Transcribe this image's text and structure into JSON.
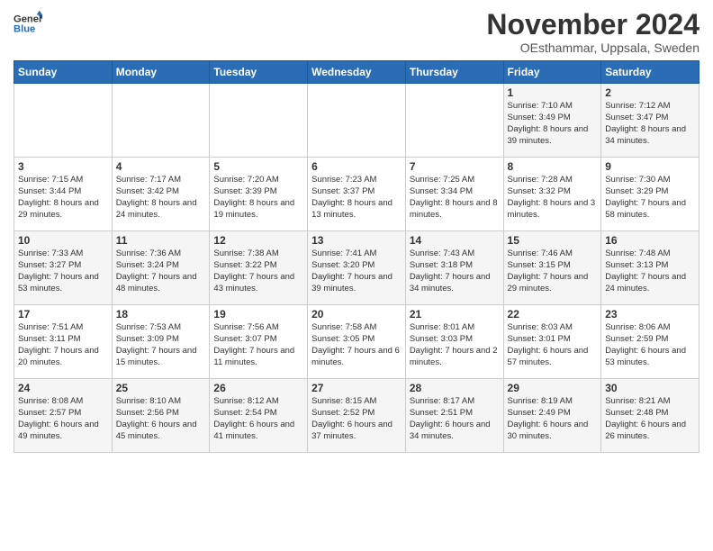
{
  "header": {
    "logo_line1": "General",
    "logo_line2": "Blue",
    "month": "November 2024",
    "location": "OEsthammar, Uppsala, Sweden"
  },
  "weekdays": [
    "Sunday",
    "Monday",
    "Tuesday",
    "Wednesday",
    "Thursday",
    "Friday",
    "Saturday"
  ],
  "weeks": [
    [
      {
        "day": "",
        "info": ""
      },
      {
        "day": "",
        "info": ""
      },
      {
        "day": "",
        "info": ""
      },
      {
        "day": "",
        "info": ""
      },
      {
        "day": "",
        "info": ""
      },
      {
        "day": "1",
        "info": "Sunrise: 7:10 AM\nSunset: 3:49 PM\nDaylight: 8 hours and 39 minutes."
      },
      {
        "day": "2",
        "info": "Sunrise: 7:12 AM\nSunset: 3:47 PM\nDaylight: 8 hours and 34 minutes."
      }
    ],
    [
      {
        "day": "3",
        "info": "Sunrise: 7:15 AM\nSunset: 3:44 PM\nDaylight: 8 hours and 29 minutes."
      },
      {
        "day": "4",
        "info": "Sunrise: 7:17 AM\nSunset: 3:42 PM\nDaylight: 8 hours and 24 minutes."
      },
      {
        "day": "5",
        "info": "Sunrise: 7:20 AM\nSunset: 3:39 PM\nDaylight: 8 hours and 19 minutes."
      },
      {
        "day": "6",
        "info": "Sunrise: 7:23 AM\nSunset: 3:37 PM\nDaylight: 8 hours and 13 minutes."
      },
      {
        "day": "7",
        "info": "Sunrise: 7:25 AM\nSunset: 3:34 PM\nDaylight: 8 hours and 8 minutes."
      },
      {
        "day": "8",
        "info": "Sunrise: 7:28 AM\nSunset: 3:32 PM\nDaylight: 8 hours and 3 minutes."
      },
      {
        "day": "9",
        "info": "Sunrise: 7:30 AM\nSunset: 3:29 PM\nDaylight: 7 hours and 58 minutes."
      }
    ],
    [
      {
        "day": "10",
        "info": "Sunrise: 7:33 AM\nSunset: 3:27 PM\nDaylight: 7 hours and 53 minutes."
      },
      {
        "day": "11",
        "info": "Sunrise: 7:36 AM\nSunset: 3:24 PM\nDaylight: 7 hours and 48 minutes."
      },
      {
        "day": "12",
        "info": "Sunrise: 7:38 AM\nSunset: 3:22 PM\nDaylight: 7 hours and 43 minutes."
      },
      {
        "day": "13",
        "info": "Sunrise: 7:41 AM\nSunset: 3:20 PM\nDaylight: 7 hours and 39 minutes."
      },
      {
        "day": "14",
        "info": "Sunrise: 7:43 AM\nSunset: 3:18 PM\nDaylight: 7 hours and 34 minutes."
      },
      {
        "day": "15",
        "info": "Sunrise: 7:46 AM\nSunset: 3:15 PM\nDaylight: 7 hours and 29 minutes."
      },
      {
        "day": "16",
        "info": "Sunrise: 7:48 AM\nSunset: 3:13 PM\nDaylight: 7 hours and 24 minutes."
      }
    ],
    [
      {
        "day": "17",
        "info": "Sunrise: 7:51 AM\nSunset: 3:11 PM\nDaylight: 7 hours and 20 minutes."
      },
      {
        "day": "18",
        "info": "Sunrise: 7:53 AM\nSunset: 3:09 PM\nDaylight: 7 hours and 15 minutes."
      },
      {
        "day": "19",
        "info": "Sunrise: 7:56 AM\nSunset: 3:07 PM\nDaylight: 7 hours and 11 minutes."
      },
      {
        "day": "20",
        "info": "Sunrise: 7:58 AM\nSunset: 3:05 PM\nDaylight: 7 hours and 6 minutes."
      },
      {
        "day": "21",
        "info": "Sunrise: 8:01 AM\nSunset: 3:03 PM\nDaylight: 7 hours and 2 minutes."
      },
      {
        "day": "22",
        "info": "Sunrise: 8:03 AM\nSunset: 3:01 PM\nDaylight: 6 hours and 57 minutes."
      },
      {
        "day": "23",
        "info": "Sunrise: 8:06 AM\nSunset: 2:59 PM\nDaylight: 6 hours and 53 minutes."
      }
    ],
    [
      {
        "day": "24",
        "info": "Sunrise: 8:08 AM\nSunset: 2:57 PM\nDaylight: 6 hours and 49 minutes."
      },
      {
        "day": "25",
        "info": "Sunrise: 8:10 AM\nSunset: 2:56 PM\nDaylight: 6 hours and 45 minutes."
      },
      {
        "day": "26",
        "info": "Sunrise: 8:12 AM\nSunset: 2:54 PM\nDaylight: 6 hours and 41 minutes."
      },
      {
        "day": "27",
        "info": "Sunrise: 8:15 AM\nSunset: 2:52 PM\nDaylight: 6 hours and 37 minutes."
      },
      {
        "day": "28",
        "info": "Sunrise: 8:17 AM\nSunset: 2:51 PM\nDaylight: 6 hours and 34 minutes."
      },
      {
        "day": "29",
        "info": "Sunrise: 8:19 AM\nSunset: 2:49 PM\nDaylight: 6 hours and 30 minutes."
      },
      {
        "day": "30",
        "info": "Sunrise: 8:21 AM\nSunset: 2:48 PM\nDaylight: 6 hours and 26 minutes."
      }
    ]
  ]
}
